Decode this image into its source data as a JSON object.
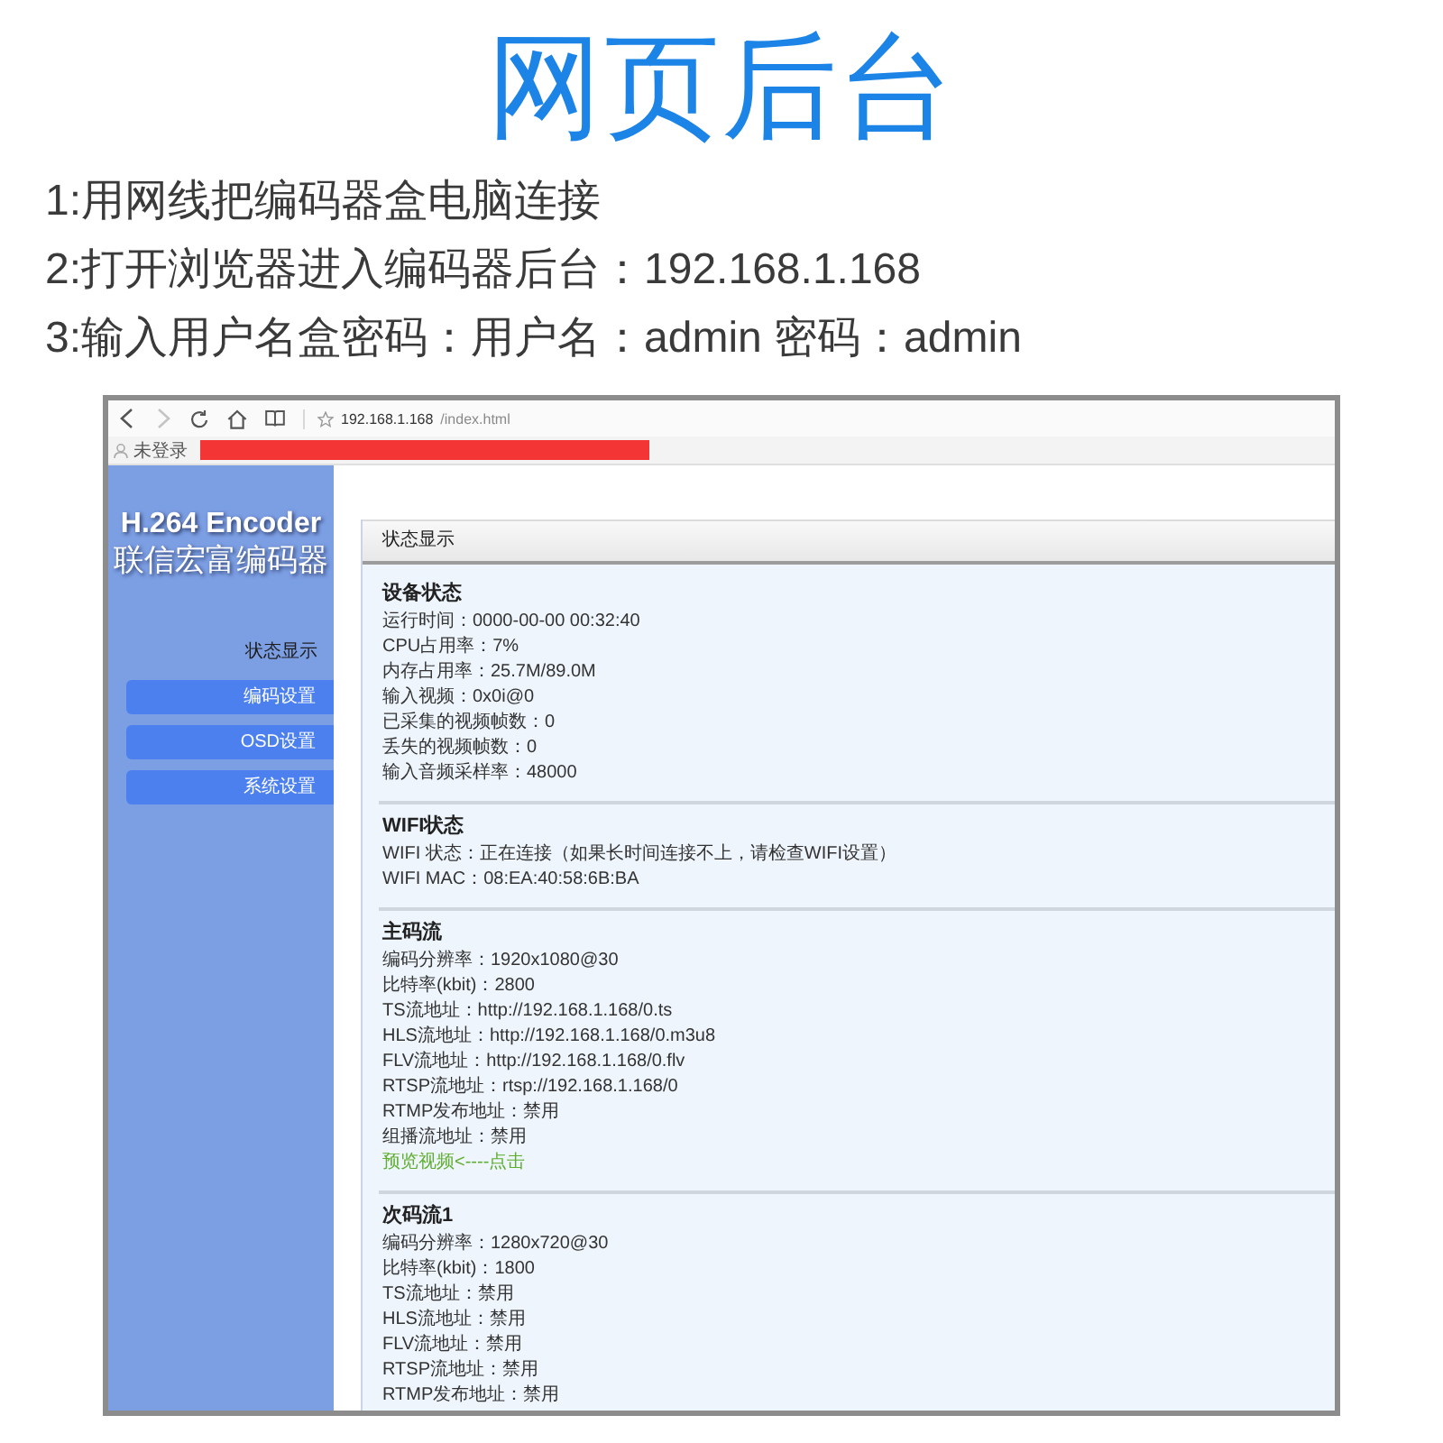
{
  "title": "网页后台",
  "instructions": [
    "1:用网线把编码器盒电脑连接",
    "2:打开浏览器进入编码器后台：192.168.1.168",
    "3:输入用户名盒密码：用户名：admin 密码：admin"
  ],
  "browser": {
    "back_disabled": false,
    "forward_disabled": true,
    "url_host": "192.168.1.168",
    "url_path": "/index.html",
    "account": "未登录"
  },
  "sidebar": {
    "logo_title": "H.264 Encoder",
    "logo_subtitle": "联信宏富编码器",
    "items": [
      {
        "label": "状态显示",
        "selected": true
      },
      {
        "label": "编码设置",
        "selected": false
      },
      {
        "label": "OSD设置",
        "selected": false
      },
      {
        "label": "系统设置",
        "selected": false
      }
    ]
  },
  "panel": {
    "title": "状态显示",
    "sections": [
      {
        "title": "设备状态",
        "rows": [
          {
            "kind": "text",
            "text": "运行时间：0000-00-00 00:32:40"
          },
          {
            "kind": "text",
            "text": "CPU占用率：7%"
          },
          {
            "kind": "text",
            "text": "内存占用率：25.7M/89.0M"
          },
          {
            "kind": "text",
            "text": "输入视频：0x0i@0"
          },
          {
            "kind": "text",
            "text": "已采集的视频帧数：0"
          },
          {
            "kind": "text",
            "text": "丢失的视频帧数：0"
          },
          {
            "kind": "text",
            "text": "输入音频采样率：48000"
          }
        ]
      },
      {
        "title": "WIFI状态",
        "rows": [
          {
            "kind": "text",
            "text": "WIFI 状态：正在连接（如果长时间连接不上，请检查WIFI设置）"
          },
          {
            "kind": "text",
            "text": "WIFI MAC：08:EA:40:58:6B:BA"
          }
        ]
      },
      {
        "title": "主码流",
        "rows": [
          {
            "kind": "text",
            "text": "编码分辨率：1920x1080@30"
          },
          {
            "kind": "text",
            "text": "比特率(kbit)：2800"
          },
          {
            "kind": "text",
            "text": "TS流地址：http://192.168.1.168/0.ts"
          },
          {
            "kind": "text",
            "text": "HLS流地址：http://192.168.1.168/0.m3u8"
          },
          {
            "kind": "text",
            "text": "FLV流地址：http://192.168.1.168/0.flv"
          },
          {
            "kind": "text",
            "text": "RTSP流地址：rtsp://192.168.1.168/0"
          },
          {
            "kind": "text",
            "text": "RTMP发布地址：禁用"
          },
          {
            "kind": "text",
            "text": "组播流地址：禁用"
          },
          {
            "kind": "link",
            "text": "预览视频<----点击"
          }
        ]
      },
      {
        "title": "次码流1",
        "rows": [
          {
            "kind": "text",
            "text": "编码分辨率：1280x720@30"
          },
          {
            "kind": "text",
            "text": "比特率(kbit)：1800"
          },
          {
            "kind": "text",
            "text": "TS流地址：禁用"
          },
          {
            "kind": "text",
            "text": "HLS流地址：禁用"
          },
          {
            "kind": "text",
            "text": "FLV流地址：禁用"
          },
          {
            "kind": "text",
            "text": "RTSP流地址：禁用"
          },
          {
            "kind": "text",
            "text": "RTMP发布地址：禁用"
          }
        ]
      }
    ]
  }
}
